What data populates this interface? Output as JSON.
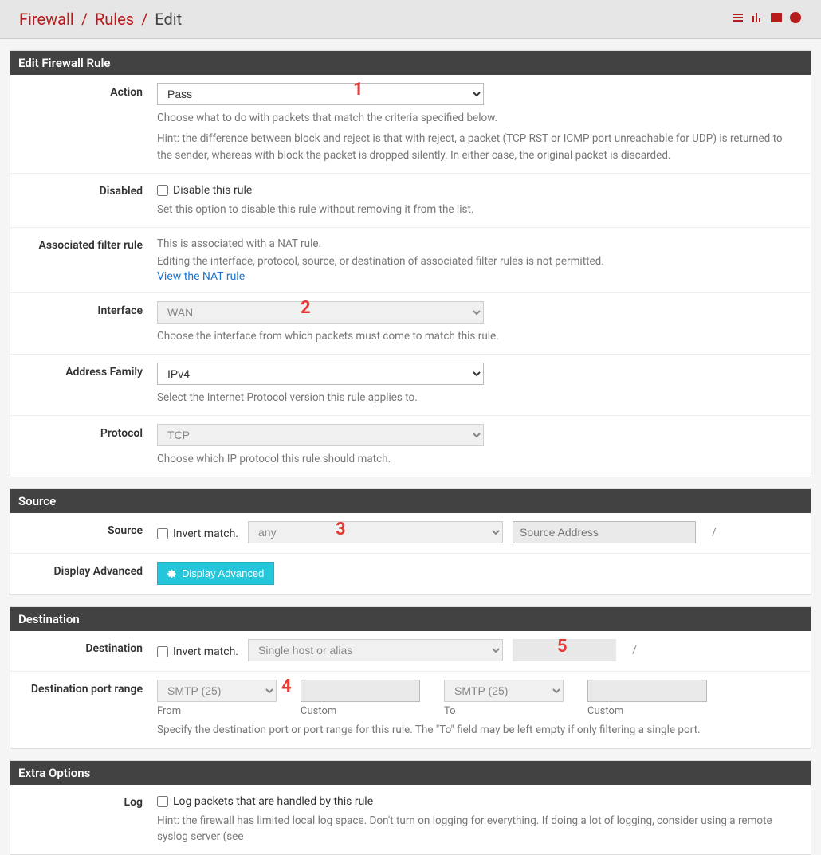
{
  "breadcrumb": {
    "a": "Firewall",
    "b": "Rules",
    "c": "Edit"
  },
  "sections": {
    "editRule": "Edit Firewall Rule",
    "source": "Source",
    "destination": "Destination",
    "extra": "Extra Options"
  },
  "labels": {
    "action": "Action",
    "disabled": "Disabled",
    "assoc": "Associated filter rule",
    "interface": "Interface",
    "family": "Address Family",
    "protocol": "Protocol",
    "source": "Source",
    "displayAdvanced": "Display Advanced",
    "destination": "Destination",
    "destPortRange": "Destination port range",
    "log": "Log"
  },
  "action": {
    "value": "Pass",
    "help": "Choose what to do with packets that match the criteria specified below.",
    "hint": "Hint: the difference between block and reject is that with reject, a packet (TCP RST or ICMP port unreachable for UDP) is returned to the sender, whereas with block the packet is dropped silently. In either case, the original packet is discarded."
  },
  "disabled": {
    "checkbox": "Disable this rule",
    "help": "Set this option to disable this rule without removing it from the list."
  },
  "assoc": {
    "l1": "This is associated with a NAT rule.",
    "l2": "Editing the interface, protocol, source, or destination of associated filter rules is not permitted.",
    "link": "View the NAT rule"
  },
  "interface": {
    "value": "WAN",
    "help": "Choose the interface from which packets must come to match this rule."
  },
  "family": {
    "value": "IPv4",
    "help": "Select the Internet Protocol version this rule applies to."
  },
  "protocol": {
    "value": "TCP",
    "help": "Choose which IP protocol this rule should match."
  },
  "source": {
    "invert": "Invert match.",
    "type": "any",
    "addrPlaceholder": "Source Address",
    "slash": "/"
  },
  "displayAdvancedBtn": "Display Advanced",
  "destination": {
    "invert": "Invert match.",
    "type": "Single host or alias",
    "addr": "",
    "slash": "/"
  },
  "destPort": {
    "from": "SMTP (25)",
    "to": "SMTP (25)",
    "fromLabel": "From",
    "customLabel": "Custom",
    "toLabel": "To",
    "custom2Label": "Custom",
    "help": "Specify the destination port or port range for this rule. The \"To\" field may be left empty if only filtering a single port."
  },
  "log": {
    "checkbox": "Log packets that are handled by this rule",
    "hint": "Hint: the firewall has limited local log space. Don't turn on logging for everything. If doing a lot of logging, consider using a remote syslog server (see"
  },
  "badges": {
    "b1": "1",
    "b2": "2",
    "b3": "3",
    "b4": "4",
    "b5": "5"
  }
}
